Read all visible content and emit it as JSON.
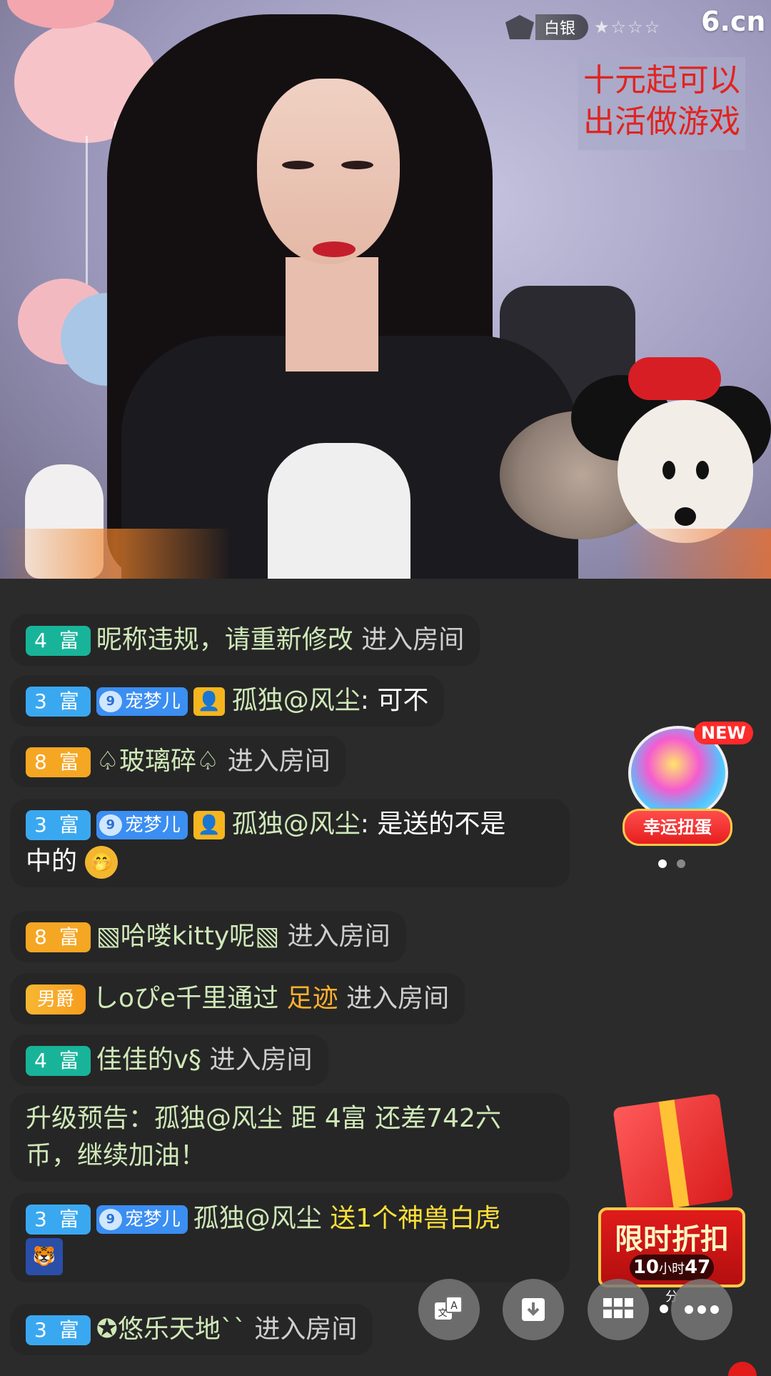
{
  "overlay": {
    "rank_label": "白银",
    "rank_stars": "★☆☆☆",
    "site_logo": "6.cn",
    "notice_line1": "十元起可以",
    "notice_line2": "出活做游戏"
  },
  "chat": {
    "messages": [
      {
        "level": "4 富",
        "name": "昵称违规，请重新修改",
        "action": "进入房间"
      },
      {
        "level": "3 富",
        "fan_badge_num": "9",
        "fan_badge": "宠梦儿",
        "user": "孤独@风尘",
        "sep": ":",
        "text": "可不"
      },
      {
        "level": "8 富",
        "name": "♤玻璃碎♤",
        "action": "进入房间"
      },
      {
        "level": "3 富",
        "fan_badge_num": "9",
        "fan_badge": "宠梦儿",
        "user": "孤独@风尘",
        "sep": ":",
        "text_a": "是送的不是",
        "text_b": "中的",
        "emoji": "🤭"
      },
      {
        "level": "8 富",
        "name": "▧哈喽kitty呢▧",
        "action": "进入房间"
      },
      {
        "noble": "男爵",
        "name": "しoぴe千里",
        "via": "通过",
        "via_link": "足迹",
        "action": "进入房间"
      },
      {
        "level": "4 富",
        "name": "佳佳的v§",
        "action": "进入房间"
      },
      {
        "text_a": "升级预告：孤独@风尘 距 4富 还差742六",
        "text_b": "币，继续加油！"
      },
      {
        "level": "3 富",
        "fan_badge_num": "9",
        "fan_badge": "宠梦儿",
        "user": "孤独@风尘",
        "gift_text": "送1个神兽白虎"
      },
      {
        "level": "3 富",
        "name": "✪悠乐天地``",
        "action": "进入房间"
      }
    ]
  },
  "widgets": {
    "egg_new": "NEW",
    "egg_label": "幸运扭蛋",
    "deal_title": "限时折扣",
    "deal_hours": "10",
    "deal_hours_unit": "小时",
    "deal_minutes": "47",
    "deal_minutes_unit": "分"
  },
  "colors": {
    "chat_green": "#cfe8b8",
    "level_4": "#18b49a",
    "level_3": "#3aa8f0",
    "level_8": "#f5a623",
    "gift_yellow": "#ffe03a",
    "notice_red": "#e0241f"
  },
  "icons": {
    "translate": "translate-icon",
    "download": "download-icon",
    "apps": "apps-grid-icon",
    "more": "more-dots-icon"
  }
}
